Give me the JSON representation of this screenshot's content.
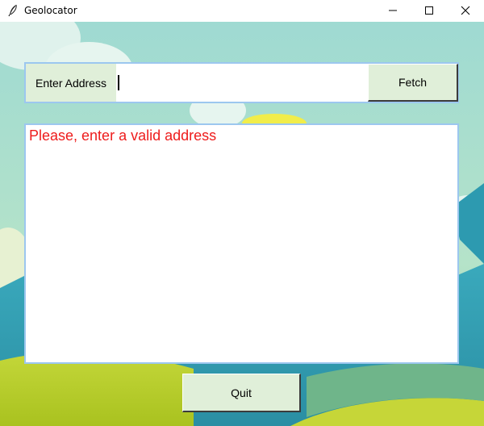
{
  "window": {
    "title": "Geolocator",
    "icon": "feather-icon",
    "controls": [
      "minimize-icon",
      "maximize-icon",
      "close-icon"
    ]
  },
  "form": {
    "address_label": "Enter Address",
    "address_value": "",
    "fetch_label": "Fetch"
  },
  "output": {
    "message": "Please, enter a valid address",
    "message_color": "#ee1c1c"
  },
  "footer": {
    "quit_label": "Quit"
  },
  "colors": {
    "button_bg": "#e0efd9",
    "frame_border": "#9cc7ef",
    "sky": "#a6dcd4"
  }
}
